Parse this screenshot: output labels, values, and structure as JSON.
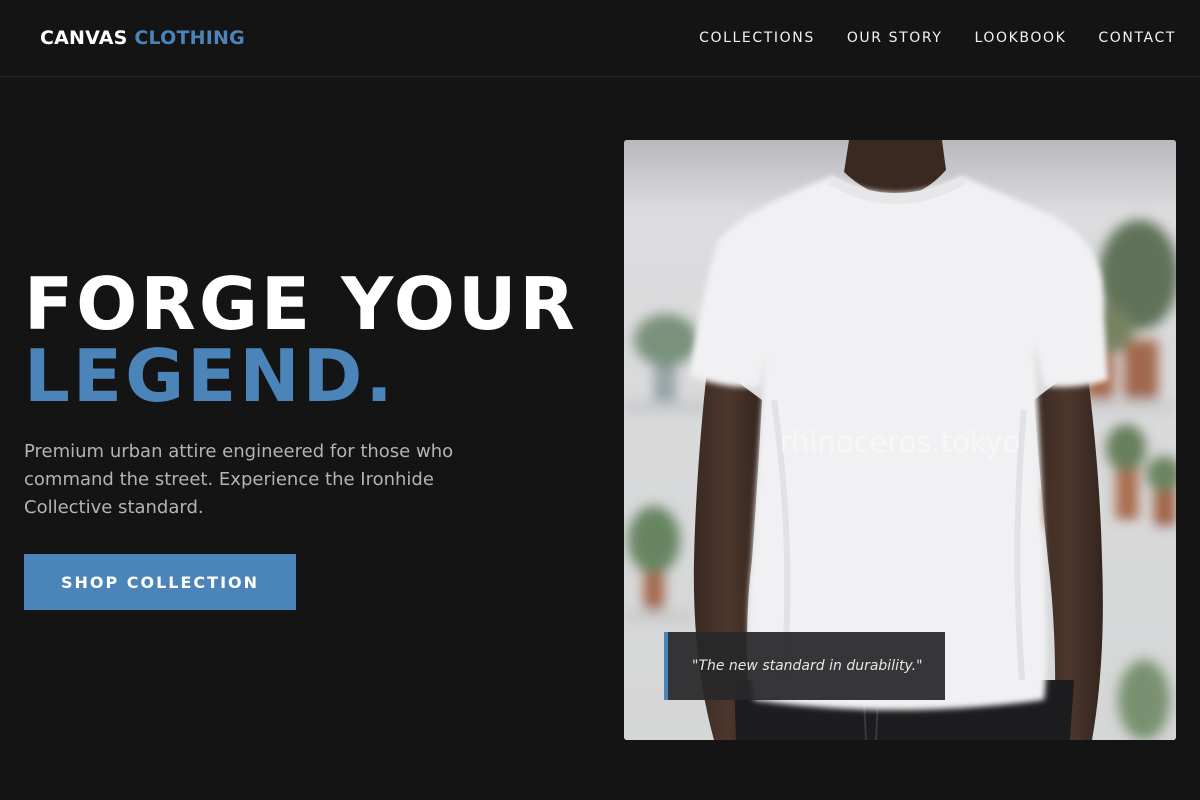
{
  "header": {
    "logo_primary": "CANVAS",
    "logo_accent": "CLOTHING",
    "nav": [
      {
        "label": "COLLECTIONS"
      },
      {
        "label": "OUR STORY"
      },
      {
        "label": "LOOKBOOK"
      },
      {
        "label": "CONTACT"
      }
    ]
  },
  "hero": {
    "title_line_1": "FORGE YOUR",
    "title_line_2": "LEGEND.",
    "subtitle": "Premium urban attire engineered for those who command the street. Experience the Ironhide Collective standard.",
    "cta_label": "SHOP COLLECTION",
    "quote": "\"The new standard in durability.\"",
    "watermark": "rhinoceros.tokyo"
  },
  "colors": {
    "background": "#141415",
    "accent": "#4a84b8",
    "text": "#ffffff",
    "muted_text": "#b3b3b8"
  }
}
